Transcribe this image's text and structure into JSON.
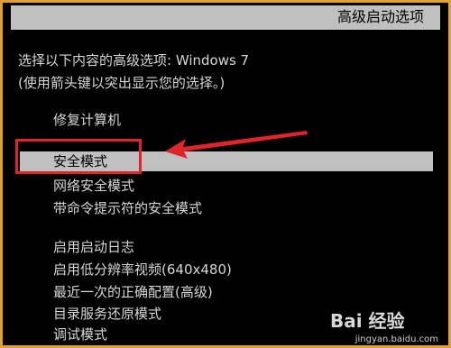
{
  "header": {
    "title": "高级启动选项"
  },
  "prompt": {
    "line1": "选择以下内容的高级选项: Windows 7",
    "line2": "(使用箭头键以突出显示您的选择。)"
  },
  "menu": {
    "items": [
      "修复计算机",
      "安全模式",
      "网络安全模式",
      "带命令提示符的安全模式",
      "启用启动日志",
      "启用低分辨率视频(640x480)",
      "最近一次的正确配置(高级)",
      "目录服务还原模式",
      "调试模式"
    ],
    "selected_item": "安全模式"
  },
  "annotation": {
    "highlight_color": "#e0242b"
  },
  "watermark": {
    "logo": "Bai 经验",
    "url": "jingyan.baidu.com"
  },
  "colors": {
    "background": "#000000",
    "highlight_bar": "#c0c0c0",
    "text": "#d6d6d6",
    "frame": "#e0a22a"
  }
}
